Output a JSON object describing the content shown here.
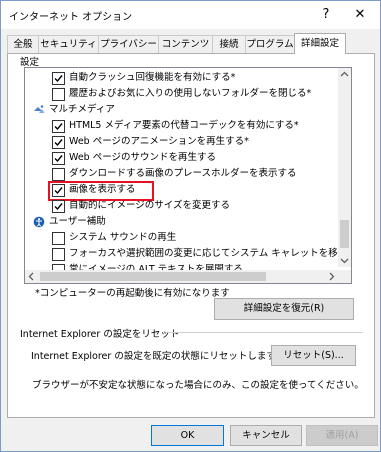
{
  "window": {
    "title": "インターネット オプション",
    "help_glyph": "?",
    "close_glyph": "✕"
  },
  "tabs": [
    {
      "label": "全般"
    },
    {
      "label": "セキュリティ"
    },
    {
      "label": "プライバシー"
    },
    {
      "label": "コンテンツ"
    },
    {
      "label": "接続"
    },
    {
      "label": "プログラム"
    },
    {
      "label": "詳細設定",
      "active": true
    }
  ],
  "settings": {
    "group_label": "設定",
    "items": [
      {
        "label": "自動クラッシュ回復機能を有効にする*",
        "checked": true
      },
      {
        "label": "履歴およびお気に入りの使用しないフォルダーを閉じる*",
        "checked": false
      },
      {
        "label": "マルチメディア",
        "category": true,
        "icon": "multimedia-icon"
      },
      {
        "label": "HTML5 メディア要素の代替コーデックを有効にする*",
        "checked": true
      },
      {
        "label": "Web ページのアニメーションを再生する*",
        "checked": true
      },
      {
        "label": "Web ページのサウンドを再生する",
        "checked": true
      },
      {
        "label": "ダウンロードする画像のプレースホルダーを表示する",
        "checked": false
      },
      {
        "label": "画像を表示する",
        "checked": true,
        "highlighted": true
      },
      {
        "label": "自動的にイメージのサイズを変更する",
        "checked": true
      },
      {
        "label": "ユーザー補助",
        "category": true,
        "icon": "accessibility-icon"
      },
      {
        "label": "システム サウンドの再生",
        "checked": false
      },
      {
        "label": "フォーカスや選択範囲の変更に応じてシステム キャレットを移動する",
        "checked": false
      },
      {
        "label": "常にイメージの ALT テキストを展開する",
        "checked": false
      }
    ],
    "highlight_color": "#e81123",
    "restart_note": "*コンピューターの再起動後に有効になります",
    "restore_button": "詳細設定を復元(R)"
  },
  "reset": {
    "group_label": "Internet Explorer の設定をリセット",
    "description": "Internet Explorer の設定を既定の状態にリセットします。",
    "button": "リセット(S)...",
    "warning": "ブラウザーが不安定な状態になった場合にのみ、この設定を使ってください。"
  },
  "footer": {
    "ok": "OK",
    "cancel": "キャンセル",
    "apply": "適用(A)"
  }
}
